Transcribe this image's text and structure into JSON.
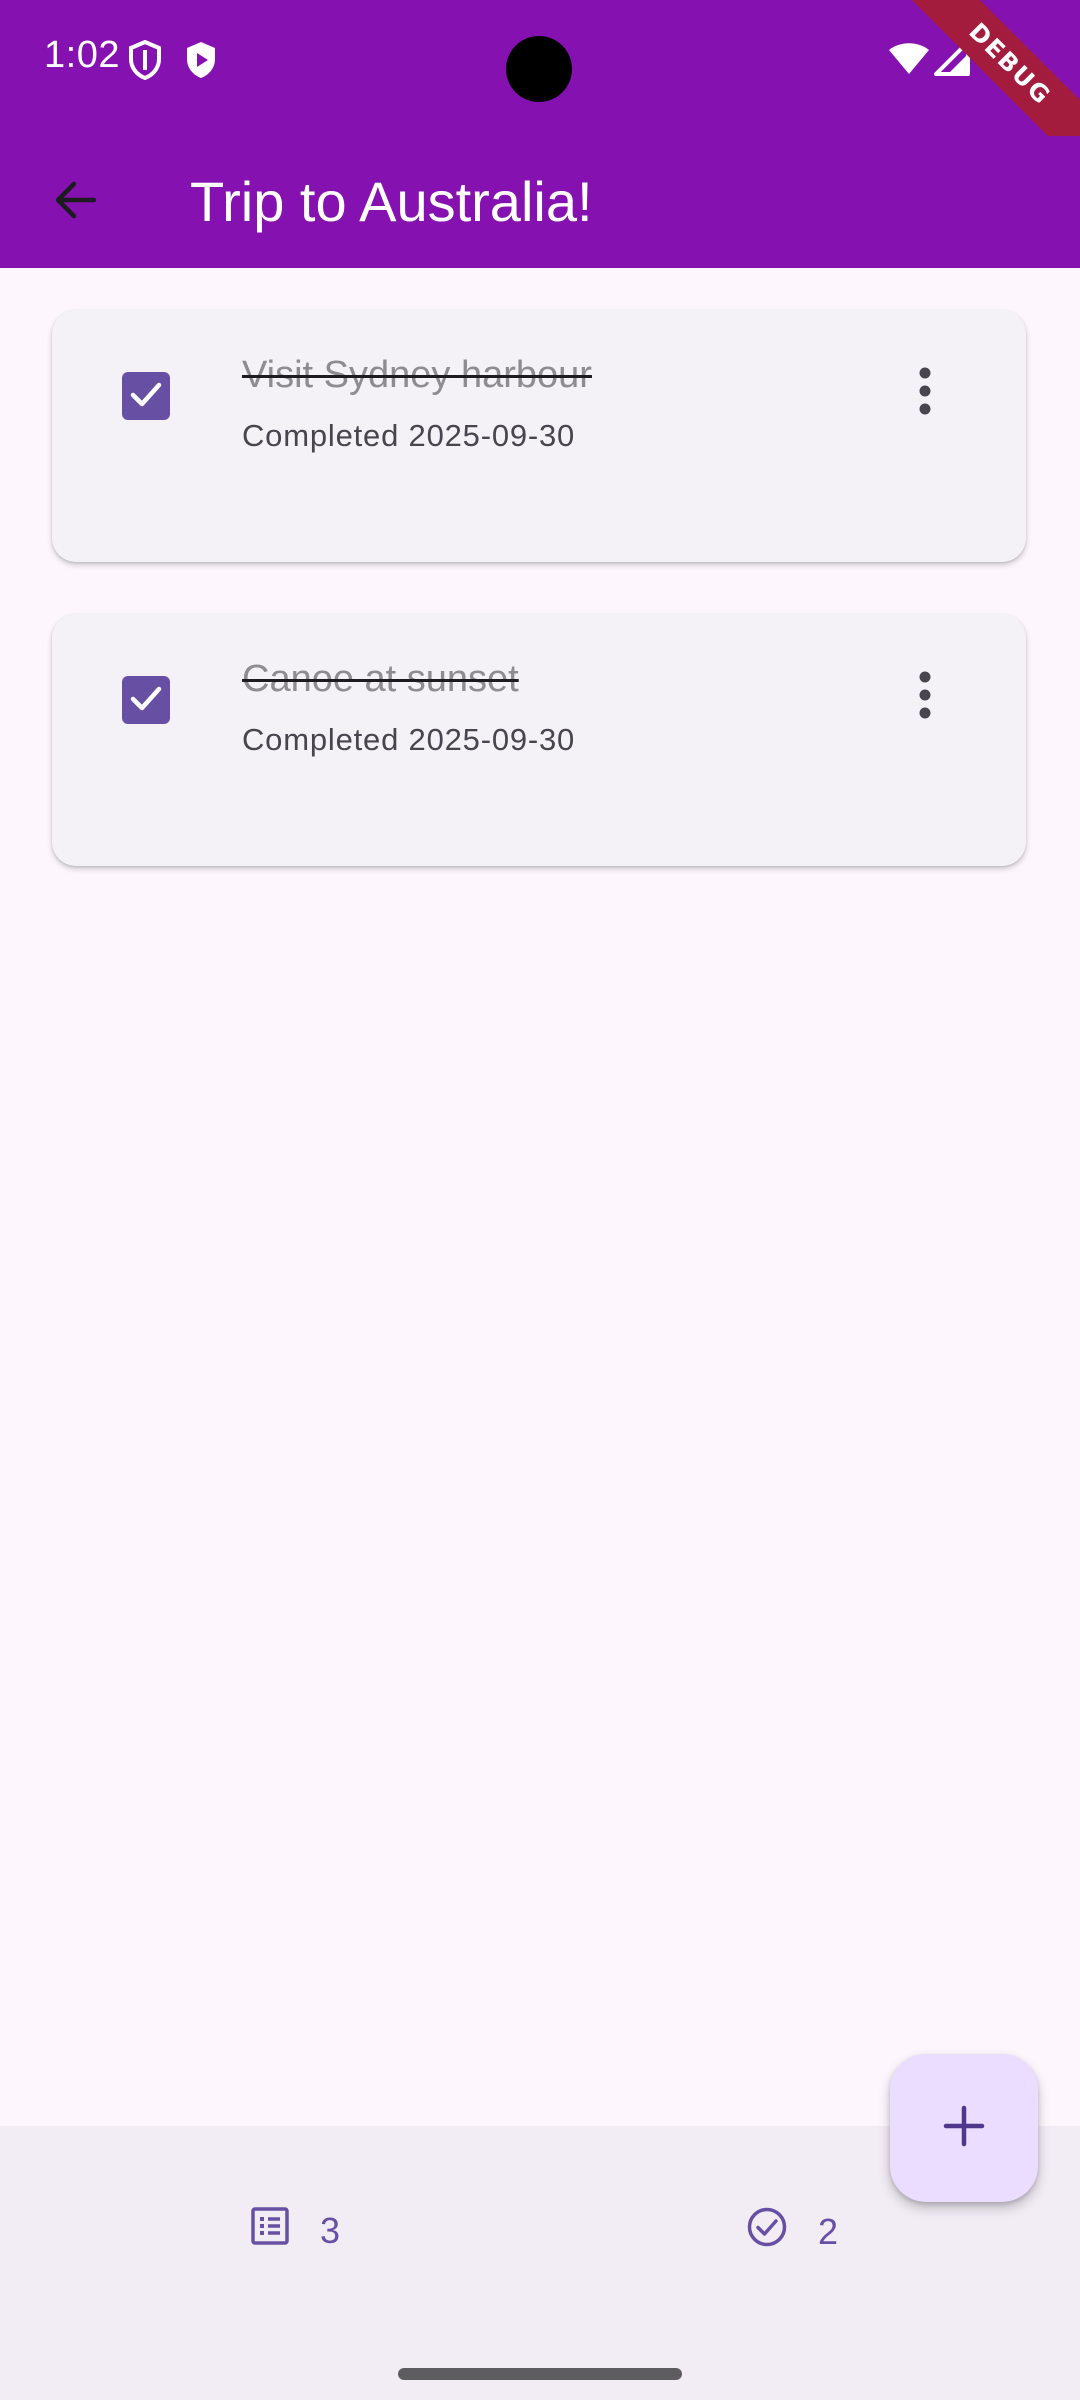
{
  "status_bar": {
    "time": "1:02",
    "icons": [
      "shield-icon",
      "play-protect-icon",
      "wifi-icon",
      "cell-signal-icon"
    ]
  },
  "debug_banner": "DEBUG",
  "app_bar": {
    "title": "Trip to Australia!",
    "back_icon": "arrow-back-icon",
    "background_color": "#8511B0"
  },
  "tasks": [
    {
      "title": "Visit Sydney harbour",
      "subtitle": "Completed 2025-09-30",
      "completed": true
    },
    {
      "title": "Canoe at sunset",
      "subtitle": "Completed 2025-09-30",
      "completed": true
    }
  ],
  "fab": {
    "icon": "plus-icon"
  },
  "bottom_bar": {
    "total_count": "3",
    "total_icon": "list-icon",
    "completed_count": "2",
    "completed_icon": "check-circle-icon"
  },
  "colors": {
    "primary": "#6750A4",
    "background": "#FDF7FD",
    "card": "#F4F1F7",
    "fab": "#EADDFF",
    "bottom_bar": "#F2ECF5"
  }
}
